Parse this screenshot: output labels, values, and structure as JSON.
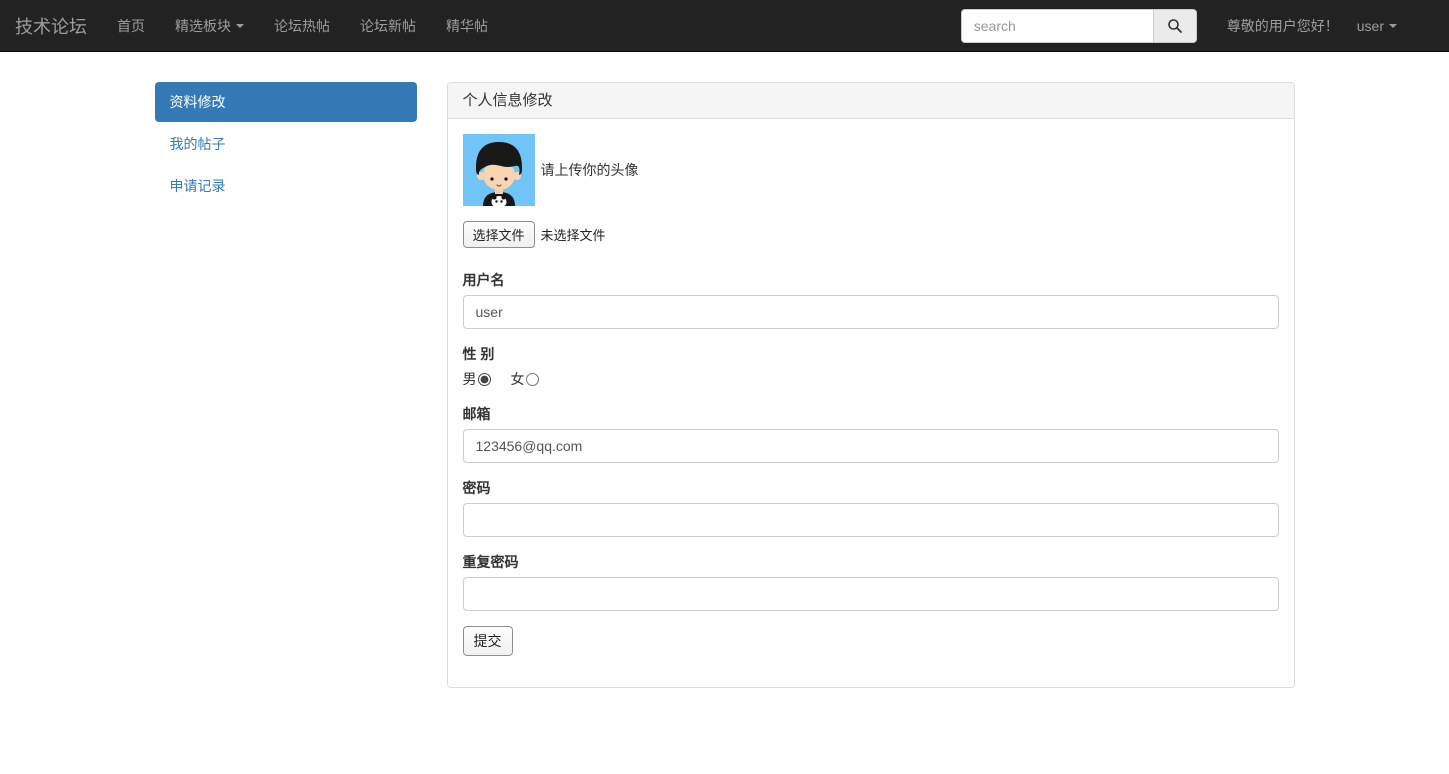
{
  "navbar": {
    "brand": "技术论坛",
    "items": [
      {
        "label": "首页"
      },
      {
        "label": "精选板块"
      },
      {
        "label": "论坛热帖"
      },
      {
        "label": "论坛新帖"
      },
      {
        "label": "精华帖"
      }
    ],
    "search": {
      "placeholder": "search"
    },
    "greeting": "尊敬的用户您好！",
    "user_menu": "user",
    "bg_color": "#222222",
    "link_color": "#9d9d9d"
  },
  "sidebar": {
    "items": [
      {
        "label": "资料修改",
        "active": true
      },
      {
        "label": "我的帖子",
        "active": false
      },
      {
        "label": "申请记录",
        "active": false
      }
    ],
    "active_color": "#337ab7"
  },
  "panel": {
    "title": "个人信息修改",
    "avatar": {
      "caption": "请上传你的头像",
      "bg_color": "#70c4f8"
    },
    "file_input": {
      "button_label": "选择文件",
      "status": "未选择文件"
    },
    "fields": {
      "username": {
        "label": "用户名",
        "value": "user"
      },
      "gender": {
        "label": "性 别",
        "options": [
          {
            "label": "男",
            "checked": true
          },
          {
            "label": "女",
            "checked": false
          }
        ]
      },
      "email": {
        "label": "邮箱",
        "value": "123456@qq.com"
      },
      "password": {
        "label": "密码",
        "value": ""
      },
      "password_repeat": {
        "label": "重复密码",
        "value": ""
      }
    },
    "submit_label": "提交"
  }
}
